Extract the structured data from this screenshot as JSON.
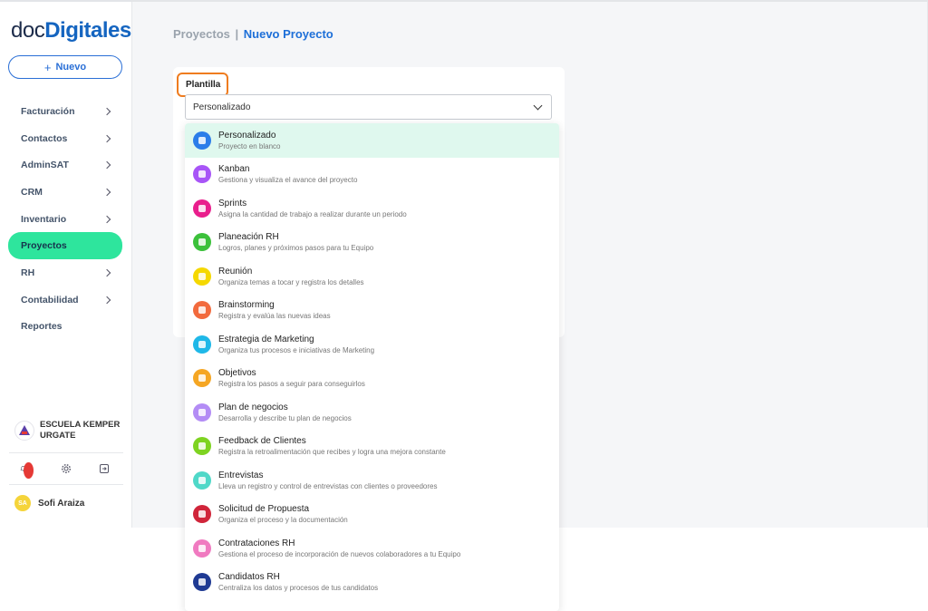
{
  "brand": {
    "logo_part1": "doc",
    "logo_part2": "Digitales"
  },
  "sidebar": {
    "new_button": {
      "icon": "+",
      "label": "Nuevo"
    },
    "items": [
      {
        "label": "Facturación",
        "has_children": true
      },
      {
        "label": "Contactos",
        "has_children": true
      },
      {
        "label": "AdminSAT",
        "has_children": true
      },
      {
        "label": "CRM",
        "has_children": true
      },
      {
        "label": "Inventario",
        "has_children": true
      },
      {
        "label": "Proyectos",
        "has_children": false,
        "active": true
      },
      {
        "label": "RH",
        "has_children": true
      },
      {
        "label": "Contabilidad",
        "has_children": true
      },
      {
        "label": "Reportes",
        "has_children": false
      }
    ],
    "organization": {
      "line1": "ESCUELA KEMPER",
      "line2": "URGATE"
    },
    "bottom_icons": [
      "bell-icon",
      "gear-icon",
      "logout-icon"
    ],
    "user": {
      "initials": "SA",
      "name": "Sofi Araiza"
    }
  },
  "breadcrumb": {
    "parent": "Proyectos",
    "separator": "|",
    "current": "Nuevo Proyecto"
  },
  "form": {
    "template_label": "Plantilla",
    "template_selected": "Personalizado"
  },
  "dropdown": {
    "options": [
      {
        "title": "Personalizado",
        "desc": "Proyecto en blanco",
        "color": "#2b7de9",
        "icon": "brush-icon",
        "selected": true
      },
      {
        "title": "Kanban",
        "desc": "Gestiona y visualiza el avance del proyecto",
        "color": "#a855f7",
        "icon": "kanban-icon"
      },
      {
        "title": "Sprints",
        "desc": "Asigna la cantidad de trabajo a realizar durante un periodo",
        "color": "#e91e8c",
        "icon": "sprint-icon"
      },
      {
        "title": "Planeación RH",
        "desc": "Logros, planes y próximos pasos para tu Equipo",
        "color": "#3cc13b",
        "icon": "team-icon"
      },
      {
        "title": "Reunión",
        "desc": "Organiza temas a tocar y registra los detalles",
        "color": "#f5d800",
        "icon": "meeting-icon"
      },
      {
        "title": "Brainstorming",
        "desc": "Registra y evalúa las nuevas ideas",
        "color": "#f26a3d",
        "icon": "lightbulb-icon"
      },
      {
        "title": "Estrategia de Marketing",
        "desc": "Organiza tus procesos e iniciativas de Marketing",
        "color": "#1fb8e8",
        "icon": "marketing-icon"
      },
      {
        "title": "Objetivos",
        "desc": "Registra los pasos a seguir para conseguirlos",
        "color": "#f5a623",
        "icon": "target-icon"
      },
      {
        "title": "Plan de negocios",
        "desc": "Desarrolla y describe tu plan de negocios",
        "color": "#b38cf5",
        "icon": "presentation-icon"
      },
      {
        "title": "Feedback de Clientes",
        "desc": "Registra la retroalimentación que recibes y logra una mejora constante",
        "color": "#7ed321",
        "icon": "feedback-icon"
      },
      {
        "title": "Entrevistas",
        "desc": "Lleva un registro y control de entrevistas con clientes o proveedores",
        "color": "#4fd8c8",
        "icon": "interview-icon"
      },
      {
        "title": "Solicitud de Propuesta",
        "desc": "Organiza el proceso y la documentación",
        "color": "#d0253a",
        "icon": "proposal-icon"
      },
      {
        "title": "Contrataciones RH",
        "desc": "Gestiona el proceso de incorporación de nuevos colaboradores a tu Equipo",
        "color": "#f07ac0",
        "icon": "hiring-icon"
      },
      {
        "title": "Candidatos RH",
        "desc": "Centraliza los datos y procesos de tus candidatos",
        "color": "#1f3a93",
        "icon": "candidates-icon"
      }
    ]
  },
  "colors": {
    "accent_green": "#2ee59d",
    "accent_blue": "#1d6fd8",
    "highlight_orange": "#ef7c1f"
  }
}
